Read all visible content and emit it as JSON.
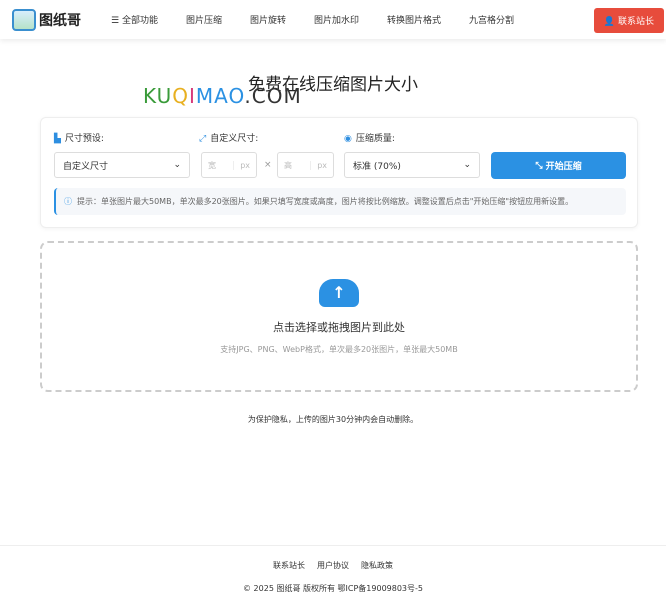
{
  "nav": {
    "logo": "图纸哥",
    "menu": [
      "全部功能",
      "图片压缩",
      "图片旋转",
      "图片加水印",
      "转换图片格式",
      "九宫格分割"
    ],
    "contact": "联系站长"
  },
  "watermark": "KUQIMAO.COM",
  "title": "免费在线压缩图片大小",
  "settings": {
    "size_preset_label": "尺寸预设:",
    "size_preset_value": "自定义尺寸",
    "custom_size_label": "自定义尺寸:",
    "width_placeholder": "宽",
    "height_placeholder": "高",
    "unit": "px",
    "times": "×",
    "quality_label": "压缩质量:",
    "quality_value": "标准 (70%)",
    "start_button": "开始压缩",
    "tip": "提示：单张图片最大50MB，单次最多20张图片。如果只填写宽度或高度，图片将按比例缩放。调整设置后点击\"开始压缩\"按钮应用新设置。"
  },
  "upload": {
    "title": "点击选择或拖拽图片到此处",
    "subtitle": "支持JPG、PNG、WebP格式，单次最多20张图片，单张最大50MB"
  },
  "privacy": "为保护隐私，上传的图片30分钟内会自动删除。",
  "footer": {
    "links": [
      "联系站长",
      "用户协议",
      "隐私政策"
    ],
    "copyright": "© 2025 图纸哥 版权所有 鄂ICP备19009803号-5"
  },
  "colors": {
    "primary": "#2b91e3",
    "danger": "#e74c3c"
  }
}
